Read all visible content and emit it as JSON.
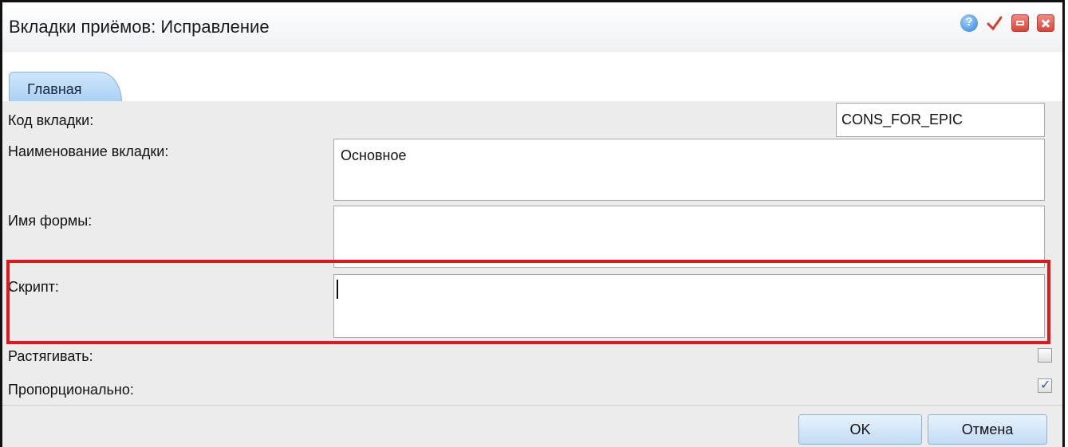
{
  "window": {
    "title": "Вкладки приёмов: Исправление",
    "icons": [
      "help-icon",
      "check-icon",
      "minimize-icon",
      "close-icon"
    ]
  },
  "tabs": [
    {
      "label": "Главная",
      "active": true
    }
  ],
  "form": {
    "tab_code": {
      "label": "Код вкладки:",
      "value": "CONS_FOR_EPIC"
    },
    "tab_name": {
      "label": "Наименование вкладки:",
      "value": "Основное"
    },
    "form_name": {
      "label": "Имя формы:",
      "value": ""
    },
    "script": {
      "label": "Скрипт:",
      "value": ""
    },
    "stretch": {
      "label": "Растягивать:",
      "checked": false
    },
    "proportional": {
      "label": "Пропорционально:",
      "checked": true
    }
  },
  "buttons": {
    "ok": "OK",
    "cancel": "Отмена"
  },
  "colors": {
    "highlight": "#e01818",
    "tab": "#a9d0f3",
    "close": "#d9463a"
  }
}
